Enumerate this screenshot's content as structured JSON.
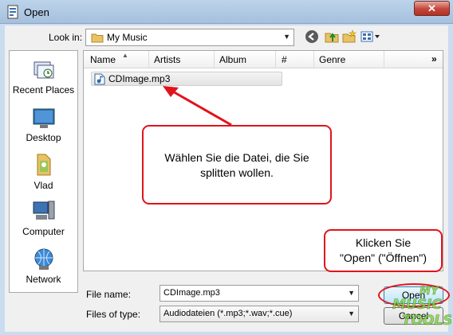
{
  "window": {
    "title": "Open",
    "close_glyph": "✕"
  },
  "toolbar": {
    "lookin_label": "Look in:",
    "lookin_value": "My Music",
    "icons": [
      "back-icon",
      "up-folder-icon",
      "new-folder-icon",
      "views-menu-icon"
    ]
  },
  "places": [
    {
      "label": "Recent Places",
      "icon": "recent-places-icon"
    },
    {
      "label": "Desktop",
      "icon": "desktop-icon"
    },
    {
      "label": "Vlad",
      "icon": "user-folder-icon"
    },
    {
      "label": "Computer",
      "icon": "computer-icon"
    },
    {
      "label": "Network",
      "icon": "network-icon"
    }
  ],
  "list": {
    "columns": [
      "Name",
      "Artists",
      "Album",
      "#",
      "Genre"
    ],
    "more": "»",
    "files": [
      {
        "name": "CDImage.mp3",
        "icon": "audio-file-icon"
      }
    ]
  },
  "callouts": {
    "select_file": [
      "Wählen Sie die Datei, die Sie",
      "splitten wollen."
    ],
    "open_hint": [
      "Klicken Sie",
      "\"Open\" (\"Öffnen\")"
    ]
  },
  "bottom": {
    "filename_label": "File name:",
    "filename_value": "CDImage.mp3",
    "filetype_label": "Files of type:",
    "filetype_value": "Audiodateien (*.mp3;*.wav;*.cue)",
    "open_label": "Open",
    "cancel_label": "Cancel"
  },
  "watermark": {
    "line1": "MY",
    "line2": "MUSIC",
    "line3": "TOOLS"
  },
  "colors": {
    "annotation_red": "#e0141c",
    "title_bar": "#b0c8e4",
    "watermark_green": "#7cd43c"
  }
}
